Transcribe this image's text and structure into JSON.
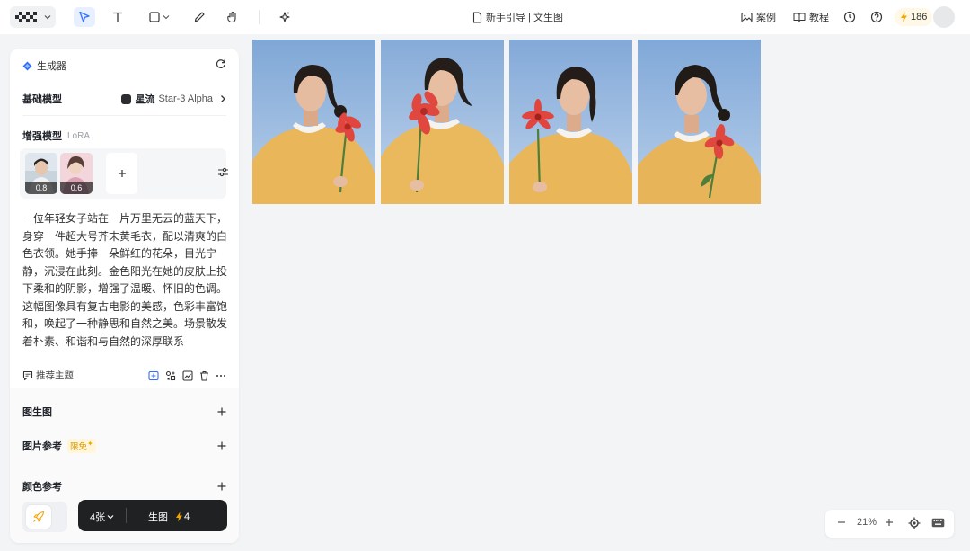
{
  "topbar": {
    "tools": [
      {
        "name": "select-tool",
        "icon": "pointer-icon",
        "active": true
      },
      {
        "name": "text-tool",
        "icon": "text-icon",
        "active": false
      },
      {
        "name": "shape-tool",
        "icon": "square-icon",
        "active": false
      },
      {
        "name": "pen-tool",
        "icon": "pen-icon",
        "active": false
      },
      {
        "name": "hand-tool",
        "icon": "hand-icon",
        "active": false
      },
      {
        "name": "magic-tool",
        "icon": "sparkle-icon",
        "active": false
      }
    ],
    "doc_title": "新手引导 | 文生图",
    "cases_label": "案例",
    "tutorial_label": "教程",
    "credits": "186"
  },
  "panel": {
    "title": "生成器",
    "base_model_label": "基础模型",
    "base_model_value_main": "星流",
    "base_model_value_sub": "Star-3 Alpha",
    "enhance_label": "增强模型",
    "enhance_tag": "LoRA",
    "loras": [
      {
        "weight": "0.8"
      },
      {
        "weight": "0.6"
      }
    ],
    "prompt": "一位年轻女子站在一片万里无云的蓝天下，身穿一件超大号芥末黄毛衣，配以清爽的白色衣领。她手捧一朵鲜红的花朵，目光宁静，沉浸在此刻。金色阳光在她的皮肤上投下柔和的阴影，增强了温暖、怀旧的色调。这幅图像具有复古电影的美感，色彩丰富饱和，唤起了一种静思和自然之美。场景散发着朴素、和谐和与自然的深厚联系",
    "recommend_label": "推荐主题",
    "sections": {
      "img2img": "图生图",
      "image_ref": "图片参考",
      "image_ref_tag": "限免",
      "color_ref": "颜色参考"
    },
    "count_label": "4张",
    "generate_label": "生图",
    "generate_cost": "4"
  },
  "zoom": {
    "level": "21%"
  },
  "colors": {
    "accent": "#3370ff",
    "bolt": "#f5a300",
    "sweater": "#e9b65a",
    "sky": "#8fb1d9"
  }
}
